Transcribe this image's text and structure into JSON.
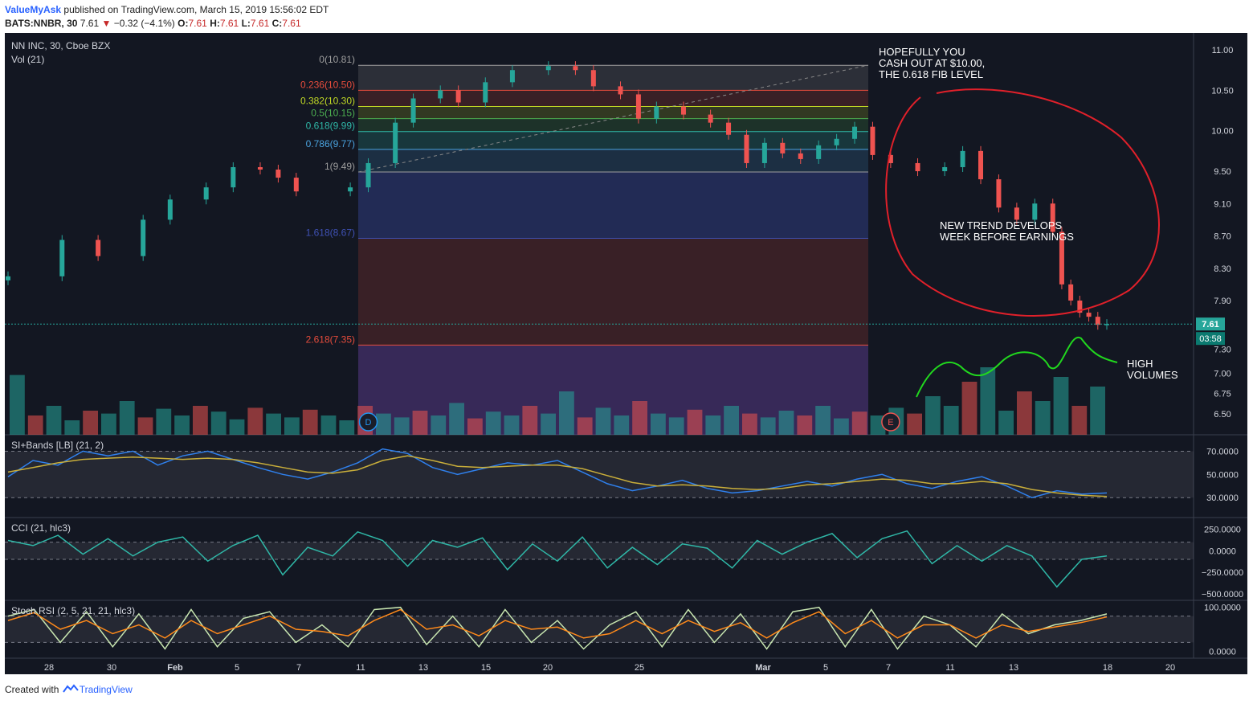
{
  "header": {
    "author": "ValueMyAsk",
    "published": "published on TradingView.com, March 15, 2019 15:56:02 EDT",
    "symbol": "BATS:NNBR, 30",
    "last": "7.61",
    "change_arrow": "▼",
    "change": "−0.32 (−4.1%)",
    "ohlc": [
      {
        "k": "O:",
        "v": "7.61"
      },
      {
        "k": "H:",
        "v": "7.61"
      },
      {
        "k": "L:",
        "v": "7.61"
      },
      {
        "k": "C:",
        "v": "7.61"
      }
    ]
  },
  "footer": {
    "created_with": "Created with",
    "brand": "TradingView",
    "icon": "tradingview-cloud-icon"
  },
  "colors": {
    "background": "#131722",
    "up": "#26a69a",
    "down": "#ef5350",
    "annotation_red": "#e0202a",
    "annotation_green": "#21d81e",
    "sma": "#c9ae3a",
    "si": "#2f80ed",
    "cci": "#2fb7a7",
    "stoch_k": "#c8e6b0",
    "stoch_d": "#ff8a1a"
  },
  "chart_data": [
    {
      "type": "candlestick",
      "title": "NN INC, 30, Cboe BZX",
      "volume_label": "Vol (21)",
      "x_ticks": [
        "28",
        "30",
        "Feb",
        "5",
        "7",
        "11",
        "13",
        "15",
        "20",
        "25",
        "Mar",
        "5",
        "7",
        "11",
        "13",
        "18",
        "20"
      ],
      "y_ticks": [
        "11.00",
        "10.50",
        "10.00",
        "9.50",
        "9.10",
        "8.70",
        "8.30",
        "7.90",
        "7.61",
        "7.30",
        "7.00",
        "6.75",
        "6.50"
      ],
      "ylim": [
        6.3,
        11.15
      ],
      "last_price": "7.61",
      "countdown": "03:58",
      "fib_levels": [
        {
          "label": "0(10.81)",
          "value": 10.81,
          "color": "#9e9e9e"
        },
        {
          "label": "0.236(10.50)",
          "value": 10.5,
          "color": "#e74c3c"
        },
        {
          "label": "0.382(10.30)",
          "value": 10.3,
          "color": "#c0d825"
        },
        {
          "label": "0.5(10.15)",
          "value": 10.15,
          "color": "#4caf50"
        },
        {
          "label": "0.618(9.99)",
          "value": 9.99,
          "color": "#2fb7a7"
        },
        {
          "label": "0.786(9.77)",
          "value": 9.77,
          "color": "#4aa3df"
        },
        {
          "label": "1(9.49)",
          "value": 9.49,
          "color": "#9e9e9e"
        },
        {
          "label": "1.618(8.67)",
          "value": 8.67,
          "color": "#3f51b5"
        },
        {
          "label": "2.618(7.35)",
          "value": 7.35,
          "color": "#e74c3c"
        }
      ],
      "series": [
        {
          "name": "NNBR",
          "points": [
            [
              0,
              8.2
            ],
            [
              3,
              8.65
            ],
            [
              5,
              8.45
            ],
            [
              7.5,
              8.9
            ],
            [
              9,
              9.15
            ],
            [
              11,
              9.3
            ],
            [
              12.5,
              9.55
            ],
            [
              14,
              9.52
            ],
            [
              15,
              9.42
            ],
            [
              16,
              9.25
            ],
            [
              19,
              9.3
            ],
            [
              20,
              9.6
            ],
            [
              21.5,
              10.1
            ],
            [
              22.5,
              10.4
            ],
            [
              24,
              10.5
            ],
            [
              25,
              10.35
            ],
            [
              26.5,
              10.6
            ],
            [
              28,
              10.75
            ],
            [
              30,
              10.8
            ],
            [
              31.5,
              10.75
            ],
            [
              32.5,
              10.55
            ],
            [
              34,
              10.45
            ],
            [
              35,
              10.15
            ],
            [
              36,
              10.3
            ],
            [
              37.5,
              10.2
            ],
            [
              39,
              10.1
            ],
            [
              40,
              9.95
            ],
            [
              41,
              9.6
            ],
            [
              42,
              9.85
            ],
            [
              43,
              9.72
            ],
            [
              44,
              9.65
            ],
            [
              45,
              9.82
            ],
            [
              46,
              9.9
            ],
            [
              47,
              10.05
            ],
            [
              48,
              9.7
            ],
            [
              49,
              9.6
            ],
            [
              50.5,
              9.5
            ],
            [
              52,
              9.55
            ],
            [
              53,
              9.75
            ],
            [
              54,
              9.4
            ],
            [
              55,
              9.05
            ],
            [
              56,
              8.9
            ],
            [
              57,
              9.1
            ],
            [
              58,
              8.75
            ],
            [
              58.5,
              8.1
            ],
            [
              59,
              7.9
            ],
            [
              59.5,
              7.75
            ],
            [
              60,
              7.7
            ],
            [
              60.5,
              7.6
            ],
            [
              61,
              7.61
            ]
          ]
        }
      ],
      "volumes": [
        0.62,
        0.2,
        0.3,
        0.15,
        0.25,
        0.22,
        0.35,
        0.18,
        0.27,
        0.2,
        0.3,
        0.24,
        0.16,
        0.28,
        0.22,
        0.18,
        0.26,
        0.2,
        0.15,
        0.3,
        0.22,
        0.18,
        0.25,
        0.2,
        0.33,
        0.17,
        0.24,
        0.2,
        0.3,
        0.22,
        0.45,
        0.18,
        0.28,
        0.2,
        0.35,
        0.22,
        0.18,
        0.26,
        0.2,
        0.3,
        0.22,
        0.18,
        0.25,
        0.2,
        0.3,
        0.17,
        0.24,
        0.2,
        0.28,
        0.22,
        0.4,
        0.3,
        0.55,
        0.7,
        0.25,
        0.45,
        0.35,
        0.6,
        0.3,
        0.5
      ],
      "events": [
        {
          "label": "D",
          "x": 20
        },
        {
          "label": "E",
          "x": 49
        }
      ],
      "annotations": [
        "HOPEFULLY YOU\nCASH OUT AT $10.00,\nTHE 0.618 FIB LEVEL",
        "NEW TREND DEVELOPS\nWEEK BEFORE EARNINGS",
        "HIGH\nVOLUMES"
      ]
    },
    {
      "type": "line",
      "title": "SI+Bands [LB] (21, 2)",
      "y_ticks": [
        "70.0000",
        "50.0000",
        "30.0000"
      ],
      "ylim": [
        17,
        80
      ],
      "bands": [
        70,
        30
      ],
      "series": [
        {
          "name": "SI",
          "values": [
            48,
            62,
            58,
            70,
            66,
            70,
            58,
            66,
            70,
            63,
            56,
            50,
            46,
            52,
            60,
            72,
            68,
            56,
            50,
            55,
            60,
            58,
            62,
            52,
            42,
            36,
            40,
            45,
            38,
            34,
            36,
            40,
            44,
            40,
            46,
            50,
            42,
            38,
            44,
            48,
            40,
            30,
            36,
            33,
            34
          ]
        },
        {
          "name": "SMA",
          "values": [
            52,
            56,
            60,
            63,
            64,
            65,
            64,
            63,
            64,
            63,
            60,
            56,
            52,
            51,
            54,
            62,
            66,
            62,
            57,
            56,
            57,
            58,
            58,
            55,
            49,
            43,
            40,
            41,
            40,
            38,
            37,
            38,
            41,
            42,
            44,
            46,
            45,
            42,
            42,
            44,
            42,
            37,
            34,
            32,
            31
          ]
        }
      ]
    },
    {
      "type": "line",
      "title": "CCI (21, hlc3)",
      "y_ticks": [
        "250.0000",
        "0.0000",
        "−250.0000",
        "−500.0000"
      ],
      "ylim": [
        -520,
        330
      ],
      "bands": [
        100,
        -100
      ],
      "series": [
        {
          "name": "CCI",
          "values": [
            120,
            60,
            180,
            -40,
            140,
            -60,
            100,
            160,
            -120,
            60,
            180,
            -280,
            40,
            -60,
            220,
            120,
            -180,
            120,
            40,
            150,
            -220,
            80,
            -120,
            160,
            -200,
            40,
            -160,
            80,
            30,
            -200,
            120,
            -40,
            100,
            200,
            -80,
            140,
            230,
            -150,
            60,
            -120,
            60,
            -60,
            -420,
            -100,
            -60
          ]
        }
      ]
    },
    {
      "type": "line",
      "title": "Stoch RSI (2, 5, 21, 21, hlc3)",
      "y_ticks": [
        "100.0000",
        "0.0000"
      ],
      "ylim": [
        -5,
        105
      ],
      "bands": [
        80,
        20
      ],
      "series": [
        {
          "name": "K",
          "values": [
            80,
            95,
            20,
            90,
            10,
            85,
            5,
            95,
            10,
            75,
            90,
            20,
            60,
            10,
            95,
            100,
            15,
            80,
            10,
            95,
            20,
            70,
            5,
            60,
            90,
            10,
            95,
            20,
            85,
            5,
            90,
            100,
            10,
            95,
            5,
            80,
            60,
            10,
            85,
            40,
            60,
            70,
            85
          ]
        },
        {
          "name": "D",
          "values": [
            70,
            88,
            50,
            70,
            40,
            60,
            30,
            70,
            40,
            60,
            80,
            50,
            45,
            35,
            70,
            95,
            50,
            60,
            35,
            70,
            50,
            55,
            30,
            40,
            70,
            40,
            70,
            45,
            65,
            30,
            65,
            90,
            40,
            70,
            30,
            60,
            60,
            30,
            60,
            45,
            55,
            65,
            78
          ]
        }
      ]
    }
  ]
}
